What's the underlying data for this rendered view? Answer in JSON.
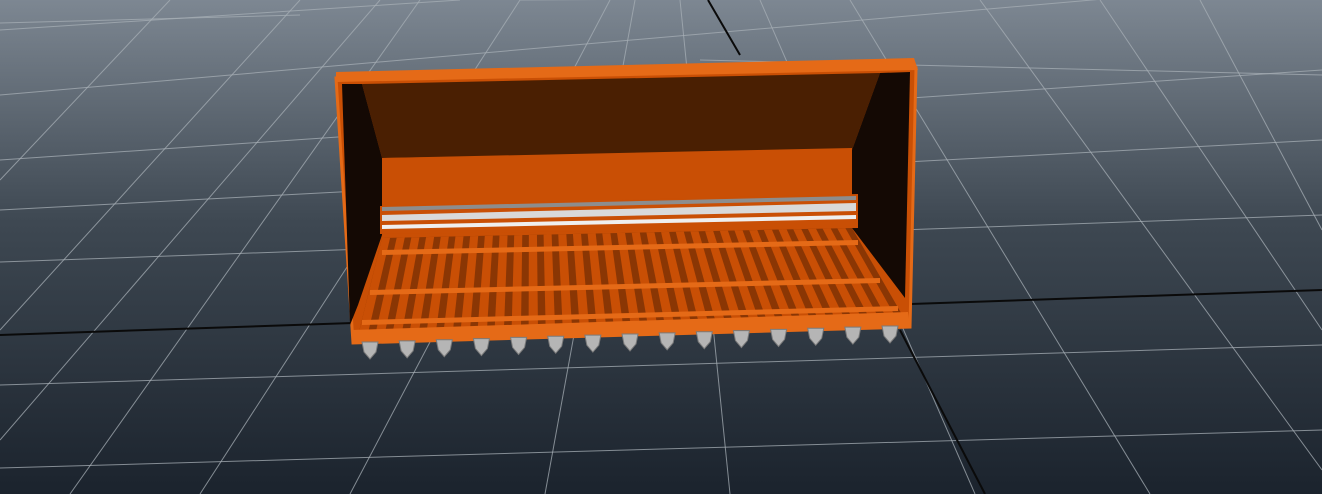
{
  "viewport": {
    "background_top": "#7d8792",
    "background_bottom": "#1b232d",
    "grid_color": "#a7afb6",
    "axis_color": "#0a0a0a"
  },
  "model": {
    "name": "bucket-with-grate-and-teeth",
    "body_color": "#c94f05",
    "edge_color": "#e56a17",
    "interior_dark_color": "#4a1f02",
    "shadow_color": "#140904",
    "roller_color": "#d9d9d9",
    "teeth_color": "#b5b5b5",
    "grate_bar_count": 32,
    "teeth_count": 15
  }
}
